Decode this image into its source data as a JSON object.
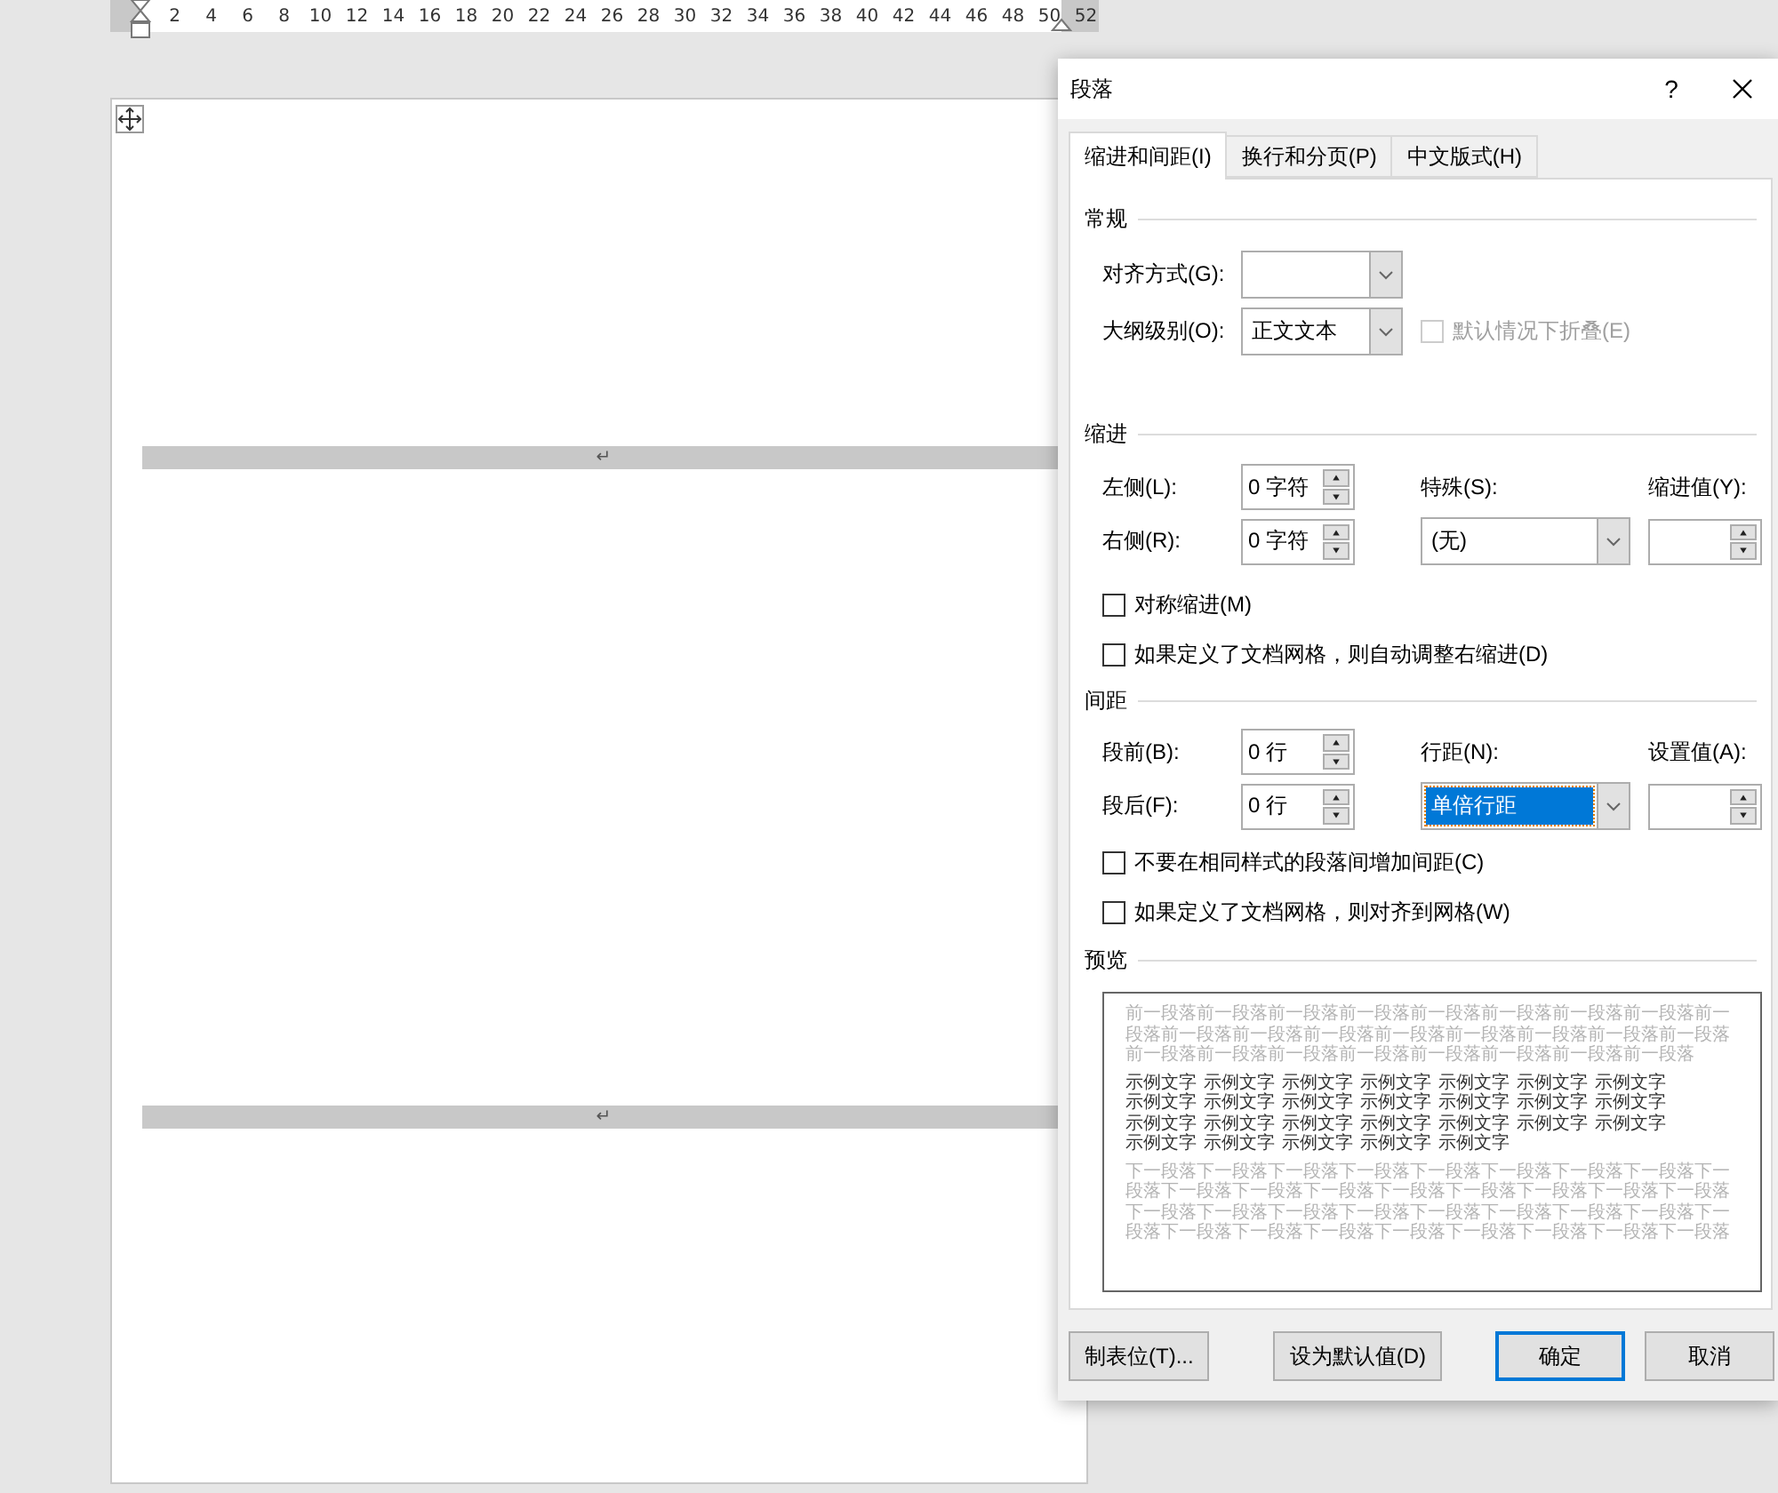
{
  "ruler": {
    "ticks": [
      "2",
      "4",
      "6",
      "8",
      "10",
      "12",
      "14",
      "16",
      "18",
      "20",
      "22",
      "24",
      "26",
      "28",
      "30",
      "32",
      "34",
      "36",
      "38",
      "40",
      "42",
      "44",
      "46",
      "48",
      "50",
      "52"
    ]
  },
  "document": {
    "paragraph_marks": [
      "↵",
      "↵"
    ]
  },
  "dialog": {
    "title": "段落",
    "help": "?",
    "tabs": [
      {
        "label": "缩进和间距(I)",
        "selected": true
      },
      {
        "label": "换行和分页(P)",
        "selected": false
      },
      {
        "label": "中文版式(H)",
        "selected": false
      }
    ],
    "general": {
      "heading": "常规",
      "alignment": {
        "label": "对齐方式(G):"
      },
      "outline": {
        "label": "大纲级别(O):",
        "value": "正文文本"
      },
      "collapse": {
        "label": "默认情况下折叠(E)",
        "checked": false,
        "disabled": true
      }
    },
    "indent": {
      "heading": "缩进",
      "left": {
        "label": "左侧(L):",
        "value": "0 字符"
      },
      "right": {
        "label": "右侧(R):",
        "value": "0 字符"
      },
      "special": {
        "label": "特殊(S):",
        "value": "(无)"
      },
      "by": {
        "label": "缩进值(Y):"
      },
      "options": [
        {
          "label": "对称缩进(M)",
          "checked": false
        },
        {
          "label": "如果定义了文档网格，则自动调整右缩进(D)",
          "checked": false
        }
      ]
    },
    "spacing": {
      "heading": "间距",
      "before": {
        "label": "段前(B):",
        "value": "0 行"
      },
      "after": {
        "label": "段后(F):",
        "value": "0 行"
      },
      "line_spacing": {
        "label": "行距(N):",
        "value": "单倍行距",
        "selected": true
      },
      "at": {
        "label": "设置值(A):"
      },
      "options": [
        {
          "label": "不要在相同样式的段落间增加间距(C)",
          "checked": false
        },
        {
          "label": "如果定义了文档网格，则对齐到网格(W)",
          "checked": false
        }
      ]
    },
    "preview": {
      "heading": "预览",
      "previous": "前一段落前一段落前一段落前一段落前一段落前一段落前一段落前一段落前一段落前一段落前一段落前一段落前一段落前一段落前一段落前一段落前一段落前一段落前一段落前一段落前一段落前一段落前一段落前一段落前一段落",
      "sample": [
        "示例文字",
        "示例文字",
        "示例文字",
        "示例文字",
        "示例文字",
        "示例文字",
        "示例文字",
        "示例文字",
        "示例文字",
        "示例文字",
        "示例文字",
        "示例文字",
        "示例文字",
        "示例文字",
        "示例文字",
        "示例文字",
        "示例文字",
        "示例文字",
        "示例文字",
        "示例文字",
        "示例文字",
        "示例文字",
        "示例文字",
        "示例文字",
        "示例文字",
        "示例文字"
      ],
      "next": "下一段落下一段落下一段落下一段落下一段落下一段落下一段落下一段落下一段落下一段落下一段落下一段落下一段落下一段落下一段落下一段落下一段落下一段落下一段落下一段落下一段落下一段落下一段落下一段落下一段落下一段落下一段落下一段落下一段落下一段落下一段落下一段落下一段落下一段落"
    },
    "buttons": [
      {
        "label": "制表位(T)...",
        "default": false
      },
      {
        "label": "设为默认值(D)",
        "default": false
      },
      {
        "label": "确定",
        "default": true
      },
      {
        "label": "取消",
        "default": false
      }
    ]
  }
}
